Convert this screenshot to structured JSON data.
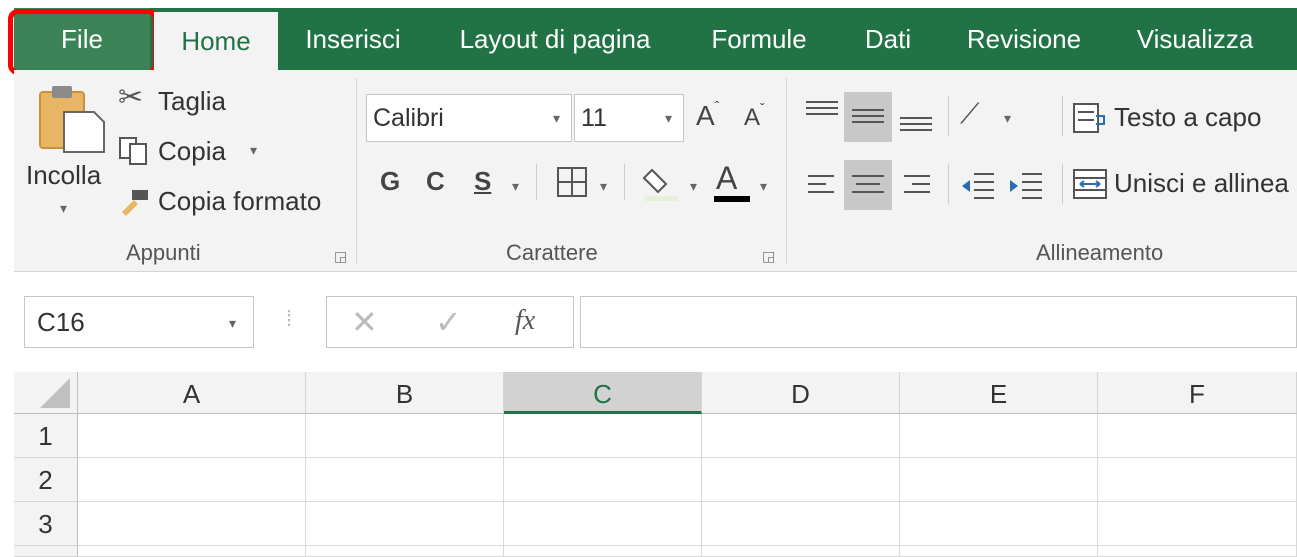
{
  "tabs": [
    {
      "label": "File"
    },
    {
      "label": "Home"
    },
    {
      "label": "Inserisci"
    },
    {
      "label": "Layout di pagina"
    },
    {
      "label": "Formule"
    },
    {
      "label": "Dati"
    },
    {
      "label": "Revisione"
    },
    {
      "label": "Visualizza"
    }
  ],
  "active_tab": "Home",
  "clipboard": {
    "paste_label": "Incolla",
    "cut_label": "Taglia",
    "copy_label": "Copia",
    "format_painter_label": "Copia formato",
    "group_label": "Appunti"
  },
  "font": {
    "name": "Calibri",
    "size": "11",
    "bold": "G",
    "italic": "C",
    "underline": "S",
    "font_color_glyph": "A",
    "grow_glyph": "A",
    "shrink_glyph": "A",
    "group_label": "Carattere"
  },
  "alignment": {
    "wrap_text_label": "Testo a capo",
    "merge_label": "Unisci e allinea",
    "group_label": "Allineamento"
  },
  "formula_bar": {
    "name_box": "C16",
    "fx_glyph": "fx",
    "content": ""
  },
  "grid": {
    "columns": [
      "A",
      "B",
      "C",
      "D",
      "E",
      "F"
    ],
    "selected_column": "C",
    "rows": [
      "1",
      "2",
      "3"
    ]
  },
  "colors": {
    "accent": "#217346",
    "highlight": "#ff0000"
  }
}
